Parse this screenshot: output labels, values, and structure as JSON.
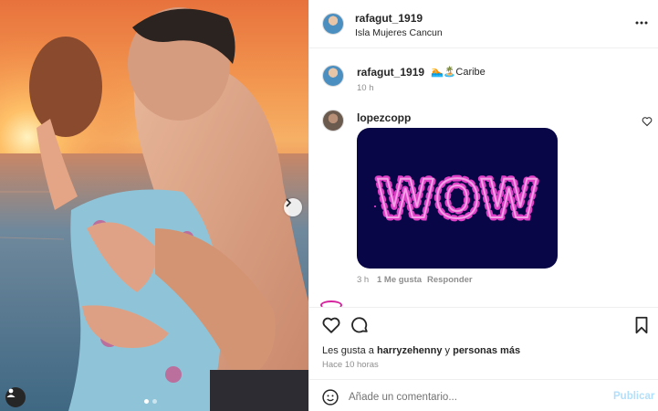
{
  "media": {
    "next_icon": "chevron-right-icon",
    "tag_icon": "user-tag-icon",
    "slides_total": 2,
    "slide_active": 1
  },
  "post": {
    "author": "rafagut_1919",
    "location": "Isla Mujeres Cancun",
    "more_icon": "more-horizontal-icon"
  },
  "caption": {
    "author": "rafagut_1919",
    "text": "🏊🏝️Caribe",
    "time": "10 h"
  },
  "comment": {
    "author": "lopezcopp",
    "gif_text": "WOW",
    "time": "3 h",
    "likes": "1 Me gusta",
    "reply": "Responder"
  },
  "actions": {
    "like_icon": "heart-icon",
    "comment_icon": "comment-icon",
    "save_icon": "bookmark-icon"
  },
  "likes": {
    "prefix": "Les gusta a ",
    "user": "harryzehenny",
    "middle": " y ",
    "others": "personas más"
  },
  "timestamp": "Hace 10 horas",
  "composer": {
    "placeholder": "Añade un comentario...",
    "publish": "Publicar"
  },
  "colors": {
    "publish_disabled": "#b2dffc",
    "gif_bg": "#080646",
    "gif_letters": "#e040c8"
  }
}
